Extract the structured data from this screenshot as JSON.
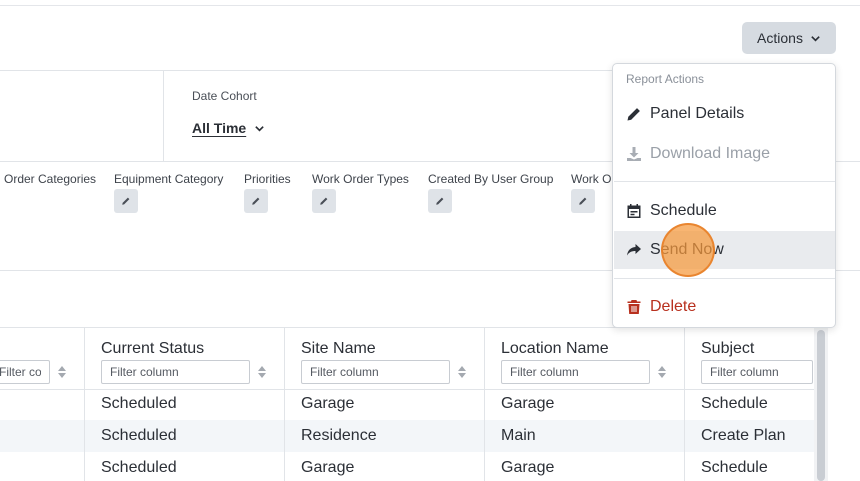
{
  "header": {
    "actions_label": "Actions"
  },
  "date_filter": {
    "label": "Date Cohort",
    "value": "All Time"
  },
  "filters": [
    {
      "label": "Order Categories"
    },
    {
      "label": "Equipment Category"
    },
    {
      "label": "Priorities"
    },
    {
      "label": "Work Order Types"
    },
    {
      "label": "Created By User Group"
    },
    {
      "label": "Work O"
    }
  ],
  "table": {
    "filter_placeholder": "Filter column",
    "columns": [
      "Current Status",
      "Site Name",
      "Location Name",
      "Subject"
    ],
    "rows": [
      [
        "Scheduled",
        "Garage",
        "Garage",
        "Schedule"
      ],
      [
        "Scheduled",
        "Residence",
        "Main",
        "Create Plan"
      ],
      [
        "Scheduled",
        "Garage",
        "Garage",
        "Schedule"
      ]
    ]
  },
  "menu": {
    "header": "Report Actions",
    "items": [
      {
        "label": "Panel Details",
        "icon": "pencil-icon"
      },
      {
        "label": "Download Image",
        "icon": "download-icon",
        "disabled": true
      },
      {
        "label": "Schedule",
        "icon": "calendar-icon"
      },
      {
        "label": "Send Now",
        "icon": "share-arrow-icon"
      },
      {
        "label": "Delete",
        "icon": "trash-icon"
      }
    ]
  },
  "colors": {
    "danger": "#b8301e",
    "cursor": "#f5983c",
    "button_bg": "#d6dbe1"
  }
}
